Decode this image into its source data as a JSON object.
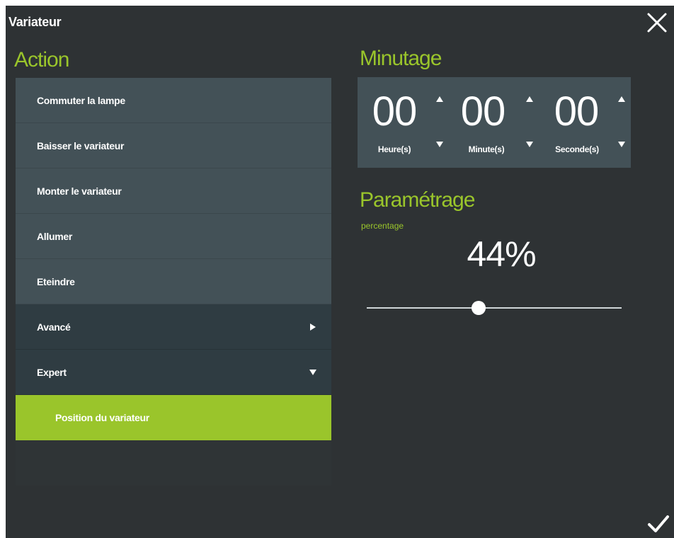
{
  "window": {
    "title": "Variateur",
    "close_icon": "close-icon",
    "confirm_icon": "check-icon"
  },
  "colors": {
    "accent": "#9ac52b",
    "background": "#2e3234",
    "panel": "#435157",
    "panel_dark": "#2f3c42"
  },
  "action": {
    "heading": "Action",
    "items": [
      {
        "label": "Commuter la lampe"
      },
      {
        "label": "Baisser le variateur"
      },
      {
        "label": "Monter le variateur"
      },
      {
        "label": "Allumer"
      },
      {
        "label": "Eteindre"
      },
      {
        "label": "Avancé",
        "icon": "triangle-right-icon"
      },
      {
        "label": "Expert",
        "icon": "triangle-down-icon"
      },
      {
        "label": "Position du variateur",
        "selected": true
      }
    ]
  },
  "minutage": {
    "heading": "Minutage",
    "hours": {
      "value": "00",
      "label": "Heure(s)"
    },
    "minutes": {
      "value": "00",
      "label": "Minute(s)"
    },
    "seconds": {
      "value": "00",
      "label": "Seconde(s)"
    }
  },
  "parametrage": {
    "heading": "Paramétrage",
    "sublabel": "percentage",
    "value_text": "44%",
    "slider_fraction": 0.44
  }
}
